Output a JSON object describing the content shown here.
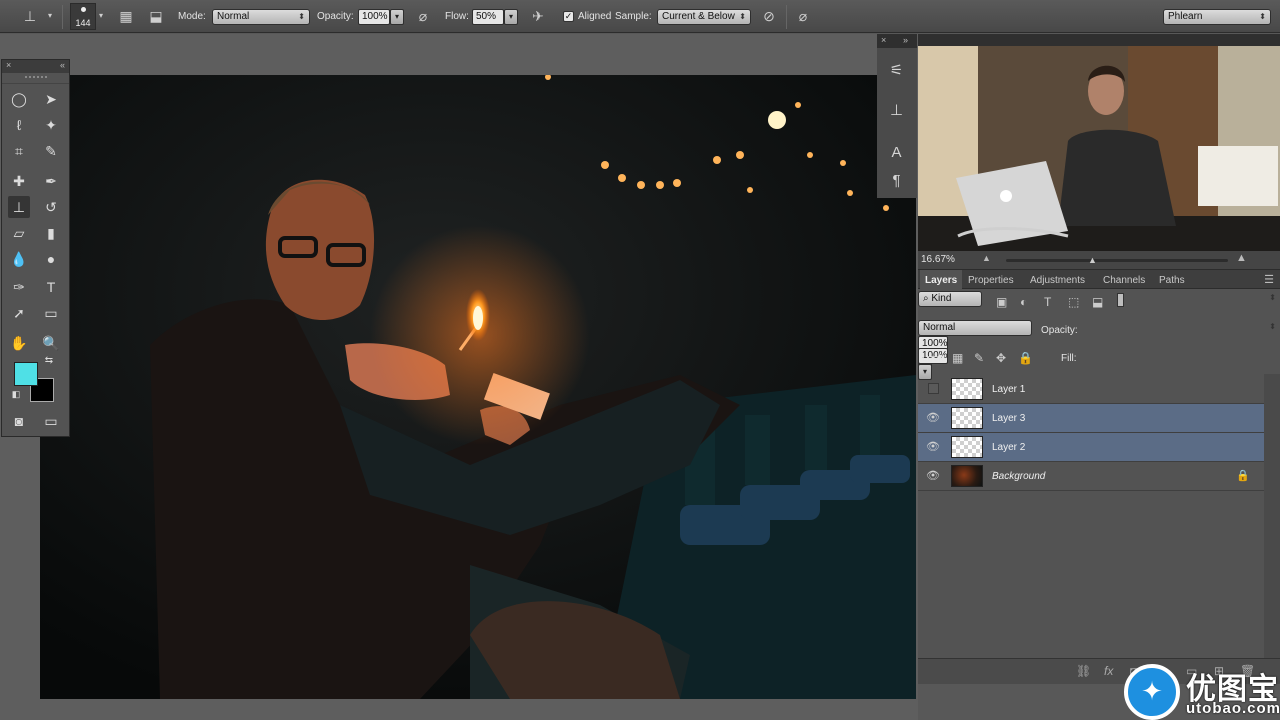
{
  "options_bar": {
    "brush_size": "144",
    "mode_label": "Mode:",
    "mode_value": "Normal",
    "opacity_label": "Opacity:",
    "opacity_value": "100%",
    "flow_label": "Flow:",
    "flow_value": "50%",
    "aligned_label": "Aligned",
    "aligned_checked": true,
    "sample_label": "Sample:",
    "sample_value": "Current & Below",
    "workspace": "Phlearn"
  },
  "colors": {
    "foreground": "#4fe0e6",
    "background": "#000000",
    "selected_layer": "#5b6c86"
  },
  "tools": [
    "elliptical-marquee-icon",
    "move-icon",
    "lasso-icon",
    "magic-wand-icon",
    "crop-icon",
    "eyedropper-icon",
    "healing-brush-icon",
    "brush-icon",
    "clone-stamp-icon",
    "history-brush-icon",
    "eraser-icon",
    "gradient-icon",
    "blur-icon",
    "dodge-icon",
    "pen-icon",
    "type-icon",
    "path-selection-icon",
    "rectangle-icon",
    "hand-icon",
    "zoom-icon"
  ],
  "active_tool": "clone-stamp-icon",
  "navigator": {
    "zoom": "16.67%"
  },
  "layers_panel": {
    "tabs": [
      "Layers",
      "Properties",
      "Adjustments",
      "Channels",
      "Paths"
    ],
    "active_tab": "Layers",
    "filter_label": "Kind",
    "blend_mode": "Normal",
    "opacity_label": "Opacity:",
    "opacity_value": "100%",
    "lock_label": "Lock:",
    "fill_label": "Fill:",
    "fill_value": "100%",
    "layers": [
      {
        "name": "Layer 1",
        "visible": false,
        "selected": false
      },
      {
        "name": "Layer 3",
        "visible": true,
        "selected": true
      },
      {
        "name": "Layer 2",
        "visible": true,
        "selected": true
      },
      {
        "name": "Background",
        "visible": true,
        "selected": false,
        "locked": true
      }
    ]
  },
  "watermark": {
    "cn": "优图宝",
    "url": "utobao.com"
  }
}
